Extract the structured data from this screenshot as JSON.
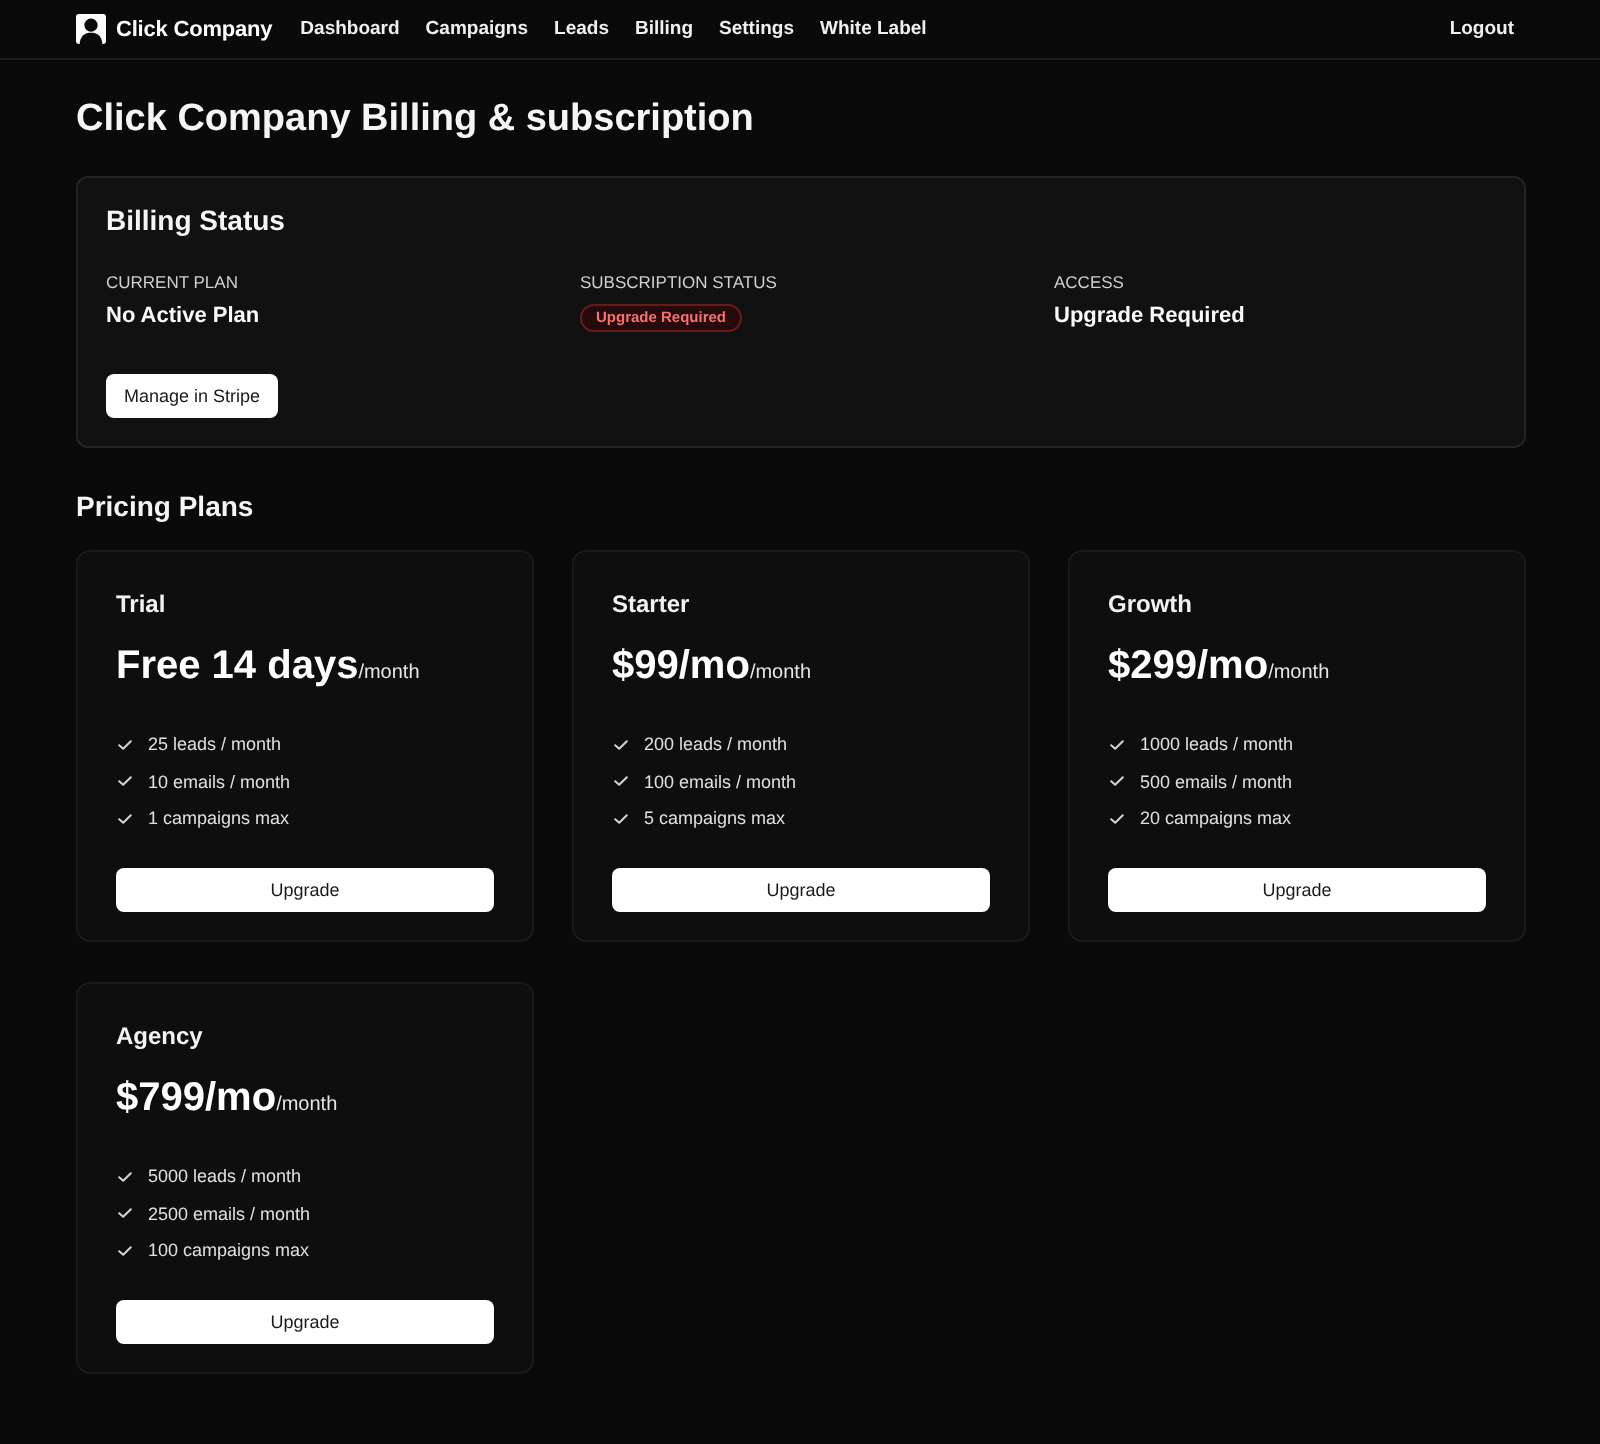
{
  "nav": {
    "brand": "Click Company",
    "links": [
      "Dashboard",
      "Campaigns",
      "Leads",
      "Billing",
      "Settings",
      "White Label"
    ],
    "logout": "Logout"
  },
  "page_title": "Click Company Billing & subscription",
  "billing_status": {
    "title": "Billing Status",
    "fields": [
      {
        "kind": "text",
        "label": "CURRENT PLAN",
        "value": "No Active Plan"
      },
      {
        "kind": "badge",
        "label": "SUBSCRIPTION STATUS",
        "value": "Upgrade Required"
      },
      {
        "kind": "text",
        "label": "ACCESS",
        "value": "Upgrade Required"
      }
    ],
    "button": "Manage in Stripe"
  },
  "pricing": {
    "title": "Pricing Plans",
    "plans": [
      {
        "name": "Trial",
        "price": "Free 14 days",
        "period": "/month",
        "features": [
          "25 leads / month",
          "10 emails / month",
          "1 campaigns max"
        ],
        "button": "Upgrade"
      },
      {
        "name": "Starter",
        "price": "$99/mo",
        "period": "/month",
        "features": [
          "200 leads / month",
          "100 emails / month",
          "5 campaigns max"
        ],
        "button": "Upgrade"
      },
      {
        "name": "Growth",
        "price": "$299/mo",
        "period": "/month",
        "features": [
          "1000 leads / month",
          "500 emails / month",
          "20 campaigns max"
        ],
        "button": "Upgrade"
      },
      {
        "name": "Agency",
        "price": "$799/mo",
        "period": "/month",
        "features": [
          "5000 leads / month",
          "2500 emails / month",
          "100 campaigns max"
        ],
        "button": "Upgrade"
      }
    ]
  }
}
